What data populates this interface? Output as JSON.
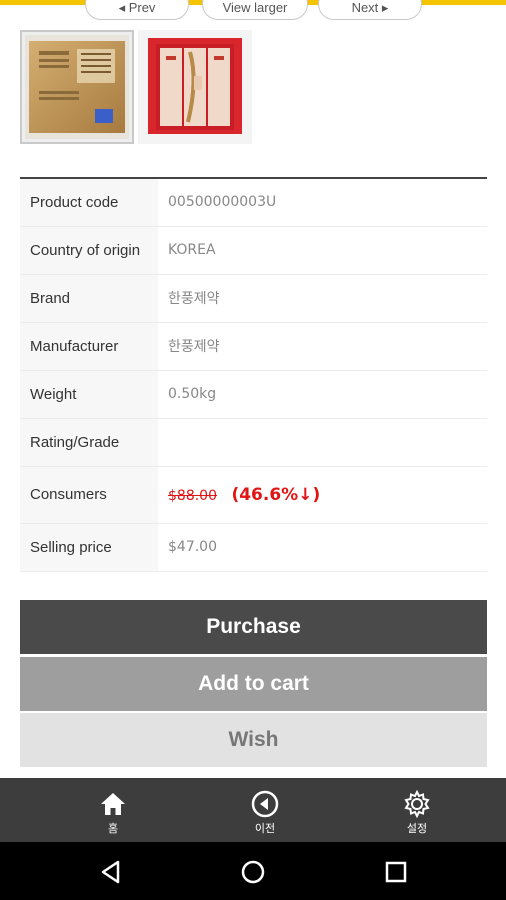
{
  "nav": {
    "prev_label": "◂ Prev",
    "larger_label": "View larger",
    "next_label": "Next ▸"
  },
  "thumbnails": [
    {
      "icon": "product-box-back-image"
    },
    {
      "icon": "product-box-front-image"
    }
  ],
  "specs": {
    "product_code": {
      "label": "Product code",
      "value": "00500000003U"
    },
    "origin": {
      "label": "Country of origin",
      "value": "KOREA"
    },
    "brand": {
      "label": "Brand",
      "value": "한풍제약"
    },
    "manufacturer": {
      "label": "Manufacturer",
      "value": "한풍제약"
    },
    "weight": {
      "label": "Weight",
      "value": "0.50kg"
    },
    "rating": {
      "label": "Rating/Grade",
      "value": ""
    },
    "consumers": {
      "label": "Consumers",
      "original_price": "$88.00",
      "discount": "(46.6%↓)"
    },
    "selling": {
      "label": "Selling price",
      "value": "$47.00"
    }
  },
  "actions": {
    "purchase": "Purchase",
    "add_to_cart": "Add to cart",
    "wish": "Wish"
  },
  "bottom_nav": {
    "home": "홈",
    "back": "이전",
    "settings": "설정"
  },
  "colors": {
    "accent": "#f5c400",
    "price_red": "#e01515",
    "purchase_bg": "#4a4a4a",
    "cart_bg": "#9e9e9e",
    "wish_bg": "#e2e2e2"
  }
}
